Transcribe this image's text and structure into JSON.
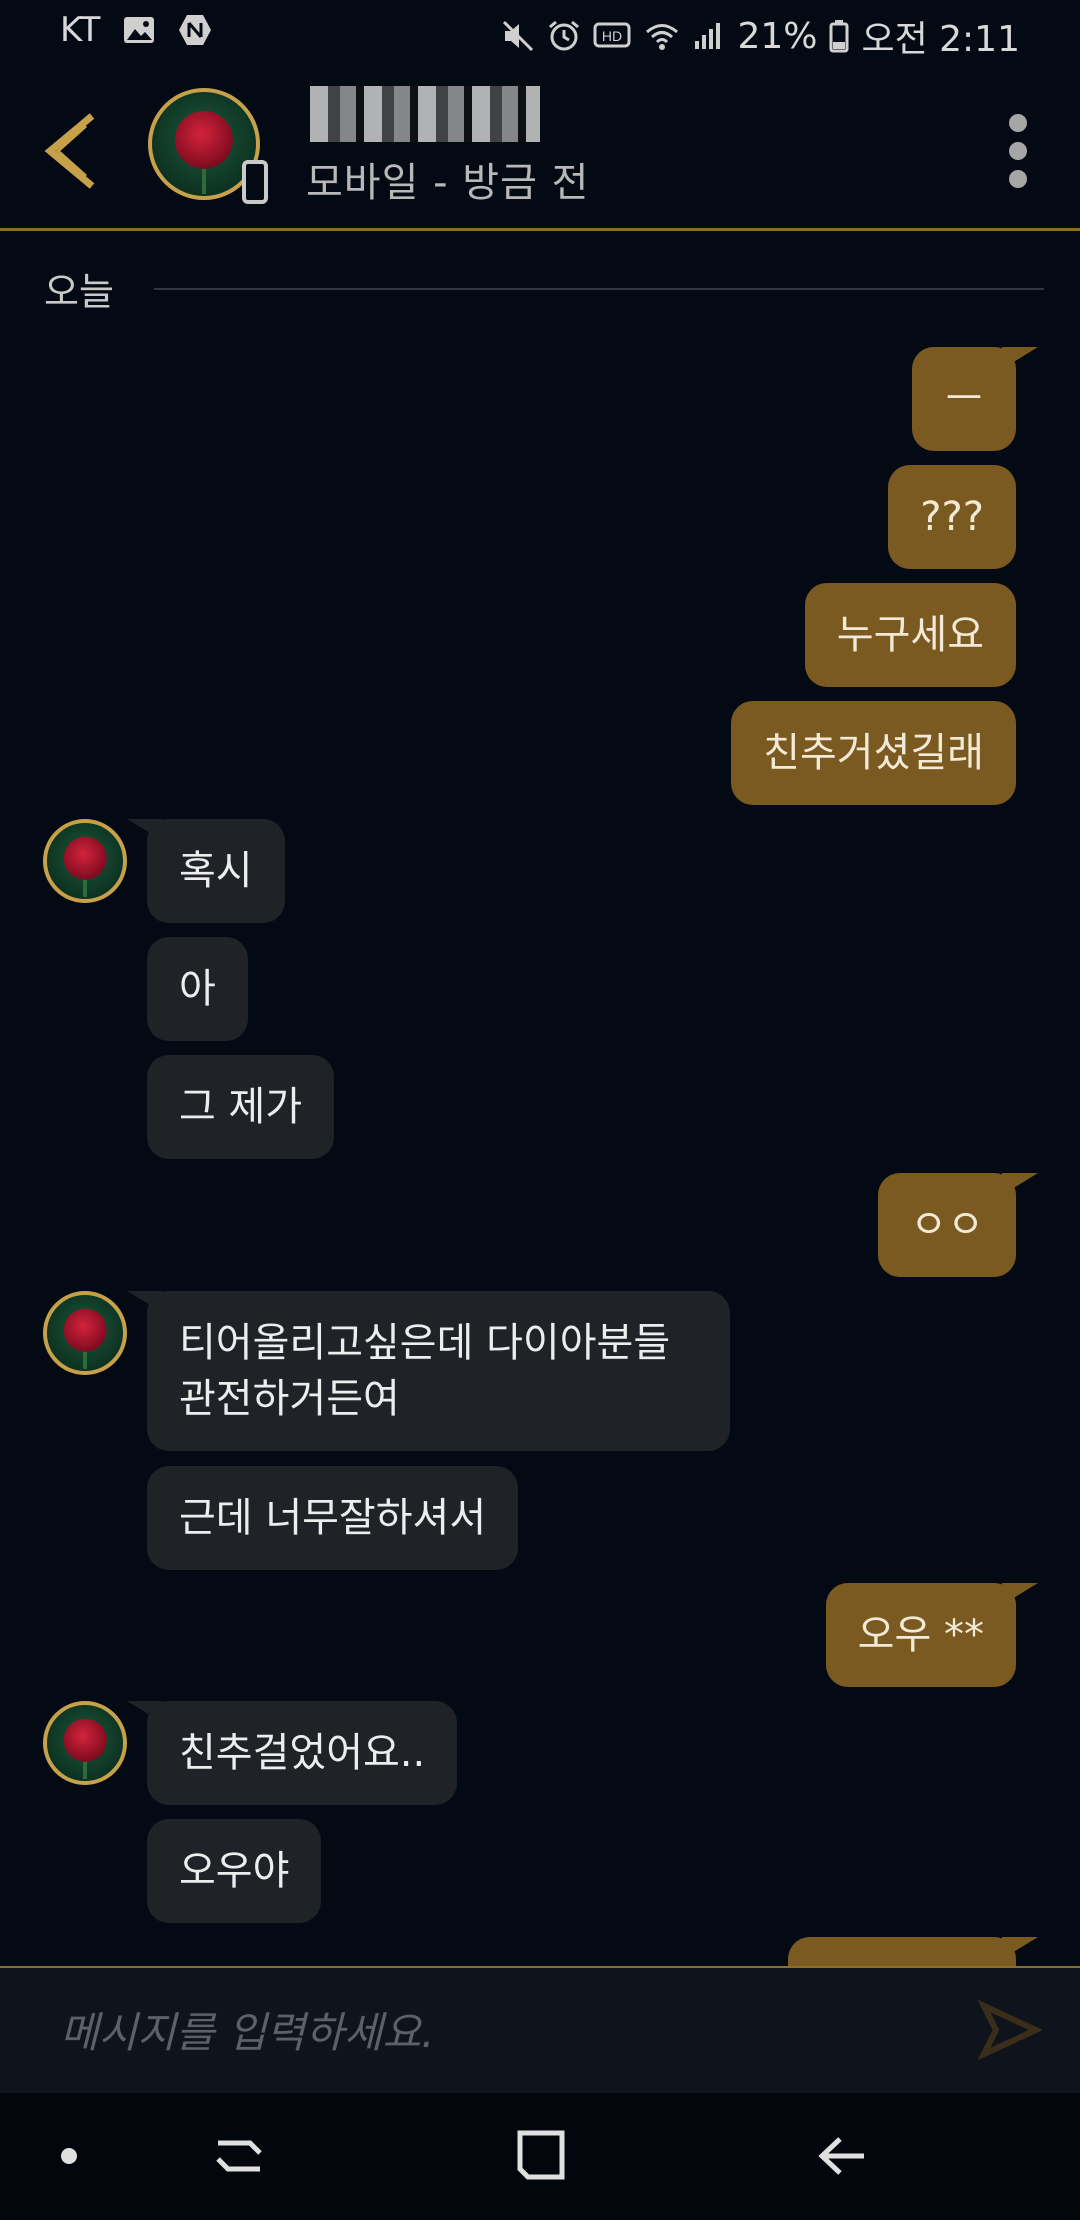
{
  "status_bar": {
    "carrier": "KT",
    "battery": "21%",
    "time": "오전 2:11",
    "icons": [
      "gallery-icon",
      "naver-icon",
      "mute-icon",
      "alarm-icon",
      "hd-icon",
      "wifi-icon",
      "signal-icon",
      "battery-icon"
    ]
  },
  "header": {
    "status": "모바일 - 방금 전",
    "accent": "#c7a14a"
  },
  "chat": {
    "date_label": "오늘",
    "messages": [
      {
        "dir": "out",
        "text": "ㅡ"
      },
      {
        "dir": "out",
        "text": "???"
      },
      {
        "dir": "out",
        "text": "누구세요"
      },
      {
        "dir": "out",
        "text": "친추거셨길래"
      },
      {
        "dir": "in",
        "text": "혹시"
      },
      {
        "dir": "in",
        "text": "아"
      },
      {
        "dir": "in",
        "text": "그 제가"
      },
      {
        "dir": "out",
        "text": "ㅇㅇ"
      },
      {
        "dir": "in",
        "text_line1": "티어올리고싶은데 다이아분들",
        "text_line2": "관전하거든여"
      },
      {
        "dir": "in",
        "text": "근데 너무잘하셔서"
      },
      {
        "dir": "out",
        "text": "오우 **"
      },
      {
        "dir": "in",
        "text": "친추걸었어요.."
      },
      {
        "dir": "in",
        "text": "오우야"
      }
    ],
    "colors": {
      "outgoing": "#7b5a22",
      "incoming": "#1f2227"
    }
  },
  "input": {
    "placeholder": "메시지를 입력하세요."
  },
  "nav": {
    "items": [
      "dot-icon",
      "recent-apps-icon",
      "home-icon",
      "back-icon"
    ]
  }
}
